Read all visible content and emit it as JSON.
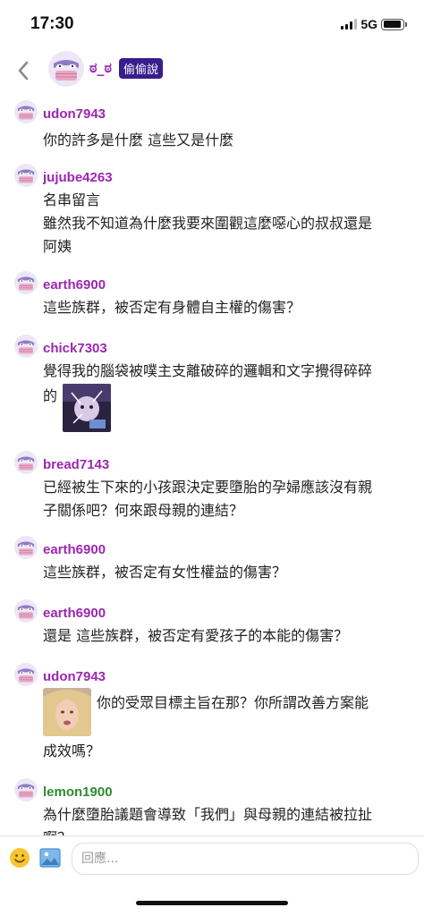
{
  "status_bar": {
    "time": "17:30",
    "network": "5G",
    "battery_level": 0.95
  },
  "header": {
    "name": "ಠ_ಠ",
    "badge": "偷偷說",
    "back_icon": "chevron-left-icon",
    "avatar_icon": "mask-avatar-icon"
  },
  "comments": [
    {
      "user": "udon7943",
      "text": "你的許多是什麼 這些又是什麼"
    },
    {
      "user": "jujube4263",
      "text": "名串留言\n雖然我不知道為什麼我要來圍觀這麼噁心的叔叔還是\n阿姨"
    },
    {
      "user": "earth6900",
      "text": "這些族群，被否定有身體自主權的傷害？"
    },
    {
      "user": "chick7303",
      "text": "覺得我的腦袋被噗主支離破碎的邏輯和文字攪得碎碎",
      "text_after_sticker": "的"
    },
    {
      "user": "bread7143",
      "text": "已經被生下來的小孩跟決定要墮胎的孕婦應該沒有親\n子關係吧？何來跟母親的連結？"
    },
    {
      "user": "earth6900",
      "text": "這些族群，被否定有女性權益的傷害？"
    },
    {
      "user": "earth6900",
      "text": "還是 這些族群，被否定有愛孩子的本能的傷害？"
    },
    {
      "user": "udon7943",
      "text": "你的受眾目標主旨在那？你所謂改善方案能",
      "text_continued": "成效嗎？"
    },
    {
      "user": "lemon1900",
      "text": "為什麼墮胎議題會導致「我們」與母親的連結被拉扯\n啊？"
    }
  ],
  "reply": {
    "placeholder": "回應..."
  },
  "colors": {
    "username": "#9b27b0",
    "username_alt": "#2e8b2e",
    "badge_bg": "#3a1d8c",
    "avatar_purple": "#8e7cc3"
  }
}
